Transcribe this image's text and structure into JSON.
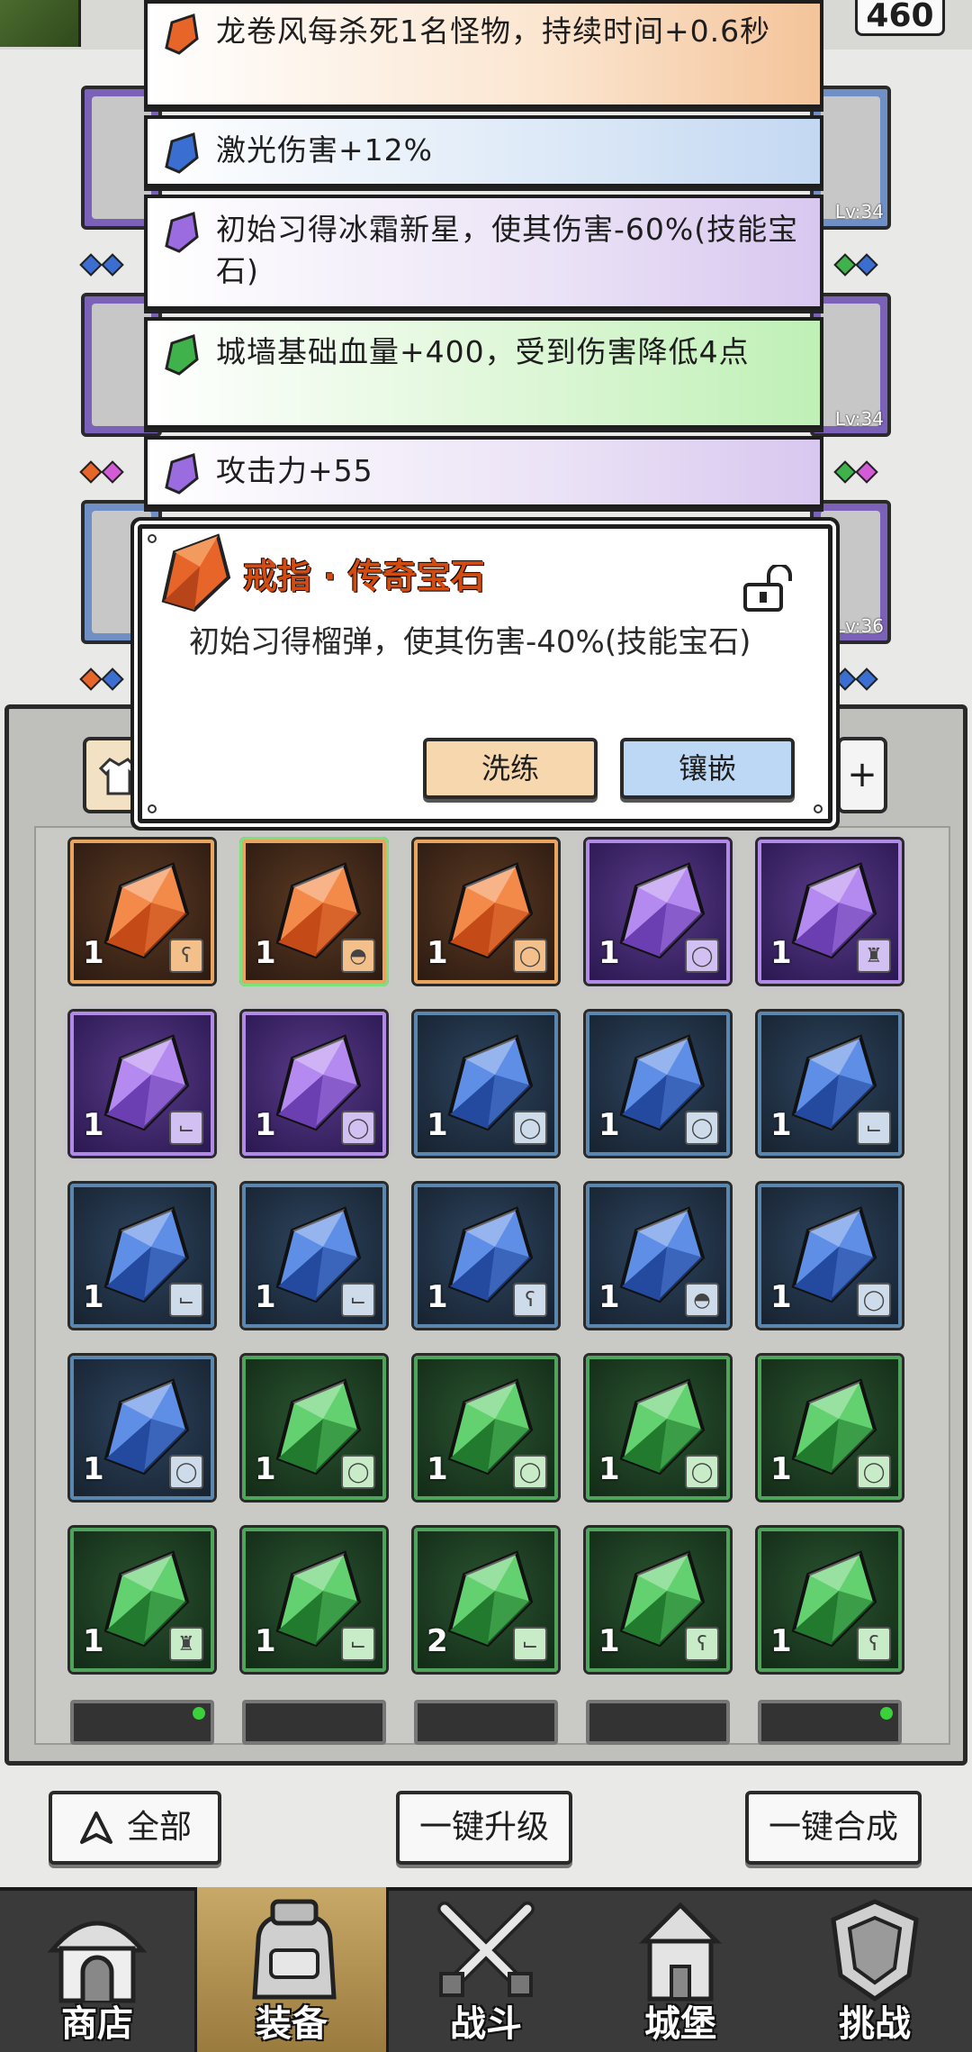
{
  "header": {
    "resource_count": "460"
  },
  "tips": [
    {
      "color": "orange",
      "gem": "orange-gem-icon",
      "text": "龙卷风每杀死1名怪物，持续时间+0.6秒"
    },
    {
      "color": "blue",
      "gem": "blue-gem-icon",
      "text": "激光伤害+12%"
    },
    {
      "color": "purple",
      "gem": "purple-gem-icon",
      "text": "初始习得冰霜新星，使其伤害-60%(技能宝石)"
    },
    {
      "color": "green",
      "gem": "green-gem-icon",
      "text": "城墙基础血量+400，受到伤害降低4点"
    },
    {
      "color": "purple",
      "gem": "purple-gem-icon",
      "text": "攻击力+55"
    }
  ],
  "equip_levels": {
    "row1": "Lv:34",
    "row2": "Lv:34",
    "row3": "Lv:36"
  },
  "popup": {
    "title": "戒指 · 传奇宝石",
    "description": "初始习得榴弹，使其伤害-40%(技能宝石)",
    "reroll_label": "洗练",
    "inlay_label": "镶嵌"
  },
  "filter": {
    "plus_label": "+"
  },
  "inventory": [
    {
      "color": "orange",
      "count": "1",
      "slot": "necklace"
    },
    {
      "color": "orange",
      "count": "1",
      "slot": "helmet",
      "selected": true
    },
    {
      "color": "orange",
      "count": "1",
      "slot": "ring"
    },
    {
      "color": "purple",
      "count": "1",
      "slot": "ring"
    },
    {
      "color": "purple",
      "count": "1",
      "slot": "armor"
    },
    {
      "color": "purple",
      "count": "1",
      "slot": "boots"
    },
    {
      "color": "purple",
      "count": "1",
      "slot": "ring"
    },
    {
      "color": "blue",
      "count": "1",
      "slot": "ring"
    },
    {
      "color": "blue",
      "count": "1",
      "slot": "ring"
    },
    {
      "color": "blue",
      "count": "1",
      "slot": "boots"
    },
    {
      "color": "blue",
      "count": "1",
      "slot": "boots"
    },
    {
      "color": "blue",
      "count": "1",
      "slot": "boots"
    },
    {
      "color": "blue",
      "count": "1",
      "slot": "necklace"
    },
    {
      "color": "blue",
      "count": "1",
      "slot": "helmet"
    },
    {
      "color": "blue",
      "count": "1",
      "slot": "ring"
    },
    {
      "color": "blue",
      "count": "1",
      "slot": "ring"
    },
    {
      "color": "green",
      "count": "1",
      "slot": "ring"
    },
    {
      "color": "green",
      "count": "1",
      "slot": "ring"
    },
    {
      "color": "green",
      "count": "1",
      "slot": "ring"
    },
    {
      "color": "green",
      "count": "1",
      "slot": "ring"
    },
    {
      "color": "green",
      "count": "1",
      "slot": "armor"
    },
    {
      "color": "green",
      "count": "1",
      "slot": "boots"
    },
    {
      "color": "green",
      "count": "2",
      "slot": "boots"
    },
    {
      "color": "green",
      "count": "1",
      "slot": "necklace"
    },
    {
      "color": "green",
      "count": "1",
      "slot": "necklace"
    }
  ],
  "actions": {
    "all_label": "全部",
    "upgrade_all": "一键升级",
    "merge_all": "一键合成"
  },
  "nav": [
    {
      "label": "商店",
      "icon": "shop-icon"
    },
    {
      "label": "装备",
      "icon": "bag-icon",
      "active": true
    },
    {
      "label": "战斗",
      "icon": "swords-icon"
    },
    {
      "label": "城堡",
      "icon": "castle-icon"
    },
    {
      "label": "挑战",
      "icon": "challenge-icon"
    }
  ],
  "colors": {
    "orange": "#e8652a",
    "blue": "#3a6fd1",
    "purple": "#9b6be0",
    "green": "#3fb24b"
  }
}
